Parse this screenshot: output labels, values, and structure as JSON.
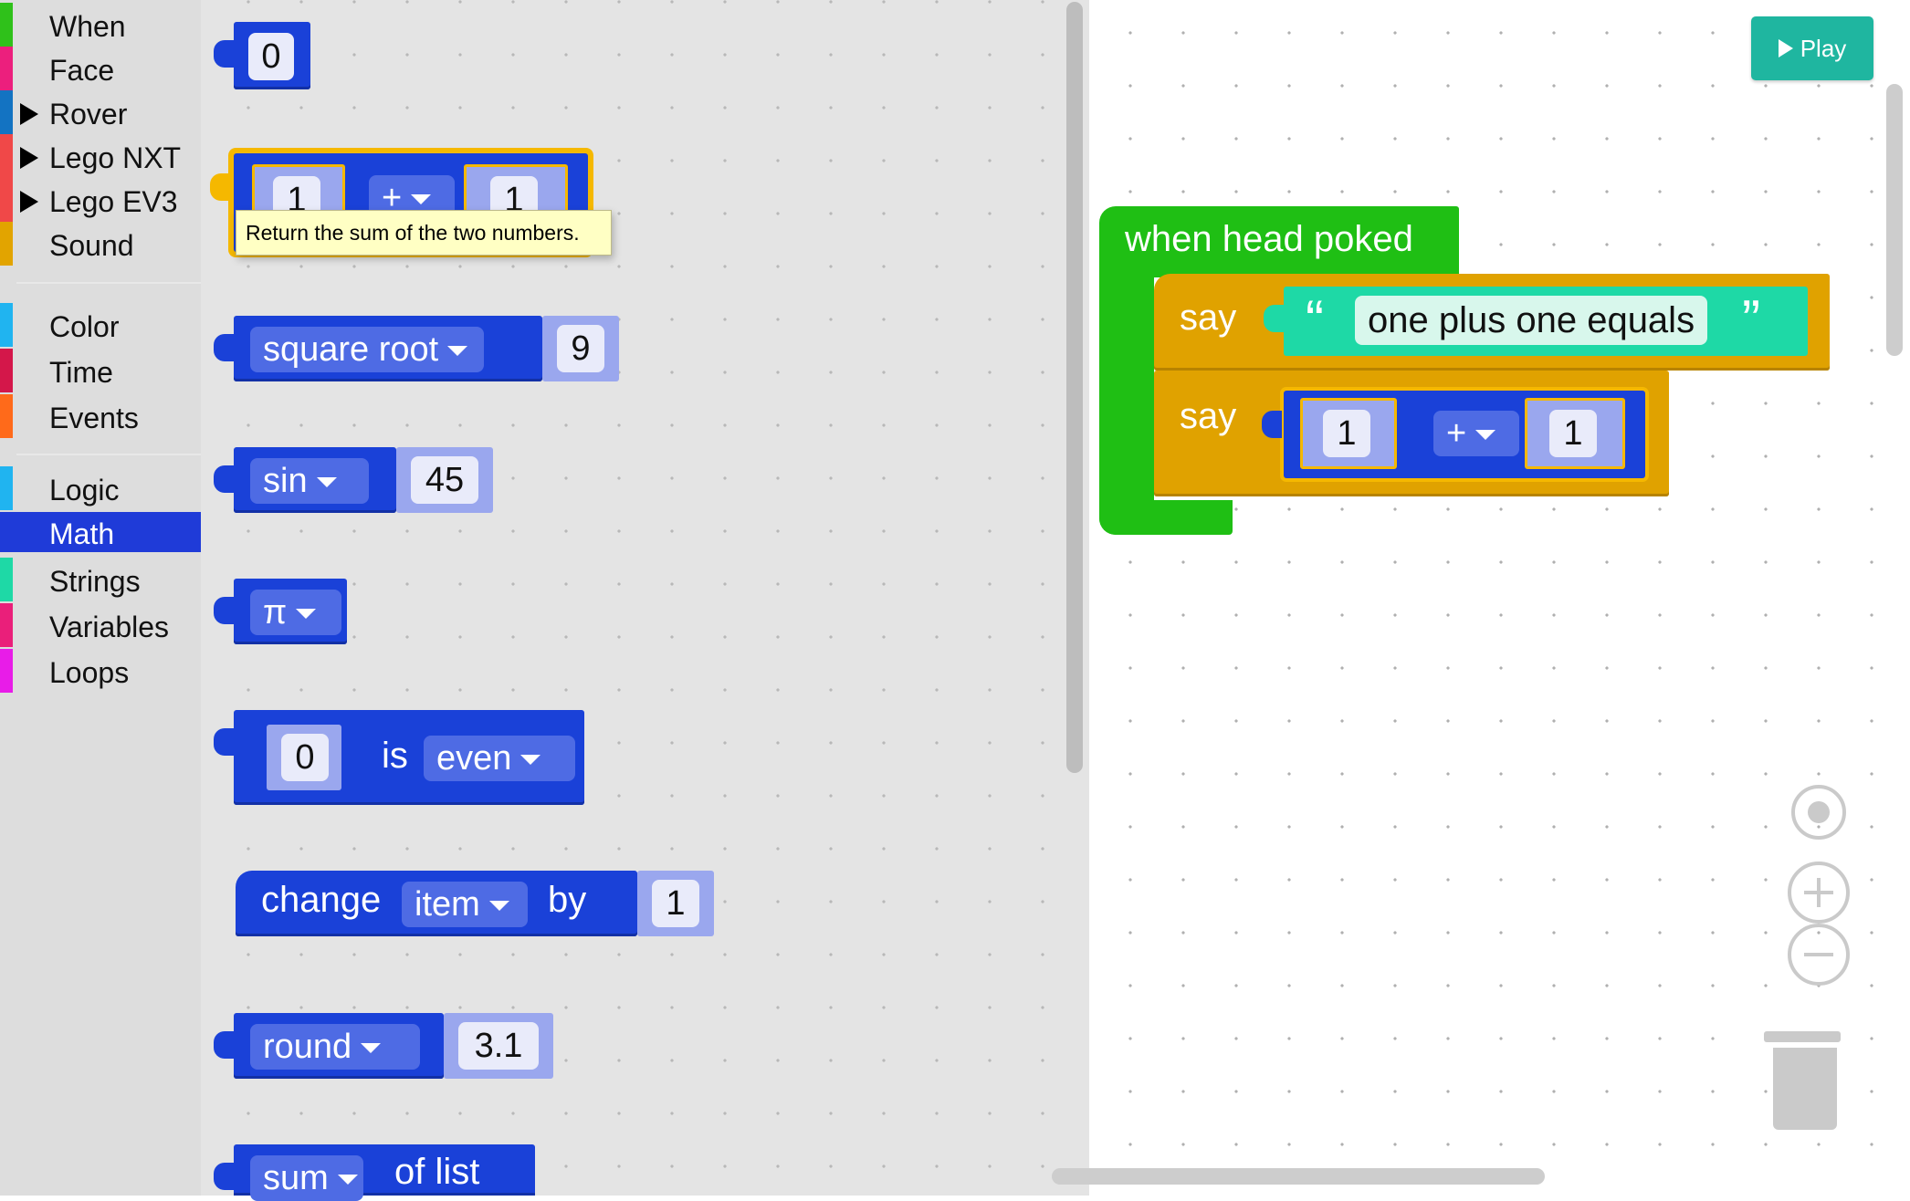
{
  "sidebar": {
    "categories": [
      {
        "label": "When",
        "color": "#2fc11a",
        "arrow": false
      },
      {
        "label": "Face",
        "color": "#ec1f7d",
        "arrow": false
      },
      {
        "label": "Rover",
        "color": "#1373c2",
        "arrow": true
      },
      {
        "label": "Lego NXT",
        "color": "#f04848",
        "arrow": true
      },
      {
        "label": "Lego EV3",
        "color": "#f04848",
        "arrow": true
      },
      {
        "label": "Sound",
        "color": "#e2a400",
        "arrow": false
      },
      {
        "label": "Color",
        "color": "#20b4f0",
        "arrow": false
      },
      {
        "label": "Time",
        "color": "#d4174a",
        "arrow": false
      },
      {
        "label": "Events",
        "color": "#ff6a1a",
        "arrow": false
      },
      {
        "label": "Logic",
        "color": "#20b4f0",
        "arrow": false
      },
      {
        "label": "Math",
        "color": "#1f3bd8",
        "arrow": false,
        "selected": true
      },
      {
        "label": "Strings",
        "color": "#1ed9a6",
        "arrow": false
      },
      {
        "label": "Variables",
        "color": "#ea1f7a",
        "arrow": false
      },
      {
        "label": "Loops",
        "color": "#e81ce8",
        "arrow": false
      }
    ]
  },
  "flyout": {
    "number_block": "0",
    "arith_block": {
      "a": "1",
      "op": "+",
      "b": "1"
    },
    "tooltip": "Return the sum of the two numbers.",
    "sqrt_block": {
      "op": "square root",
      "value": "9"
    },
    "trig_block": {
      "op": "sin",
      "value": "45"
    },
    "constant_block": {
      "op": "π"
    },
    "even_block": {
      "value": "0",
      "word": "is",
      "op": "even"
    },
    "change_block": {
      "word1": "change",
      "var": "item",
      "word2": "by",
      "value": "1"
    },
    "round_block": {
      "op": "round",
      "value": "3.1"
    },
    "sum_block": {
      "op": "sum",
      "word": "of list"
    }
  },
  "workspace": {
    "play_label": "Play",
    "event_label": "when head poked",
    "say1": {
      "label": "say",
      "open_quote": "“",
      "text": "one plus one equals",
      "close_quote": "”"
    },
    "say2": {
      "label": "say",
      "a": "1",
      "op": "+",
      "b": "1"
    },
    "icons": [
      "target-icon",
      "zoom-in-icon",
      "zoom-out-icon",
      "trash-icon"
    ],
    "colors": {
      "event": "#1fbf14",
      "say": "#e0a200",
      "math": "#1a41d8",
      "string": "#1ed9a6"
    }
  }
}
